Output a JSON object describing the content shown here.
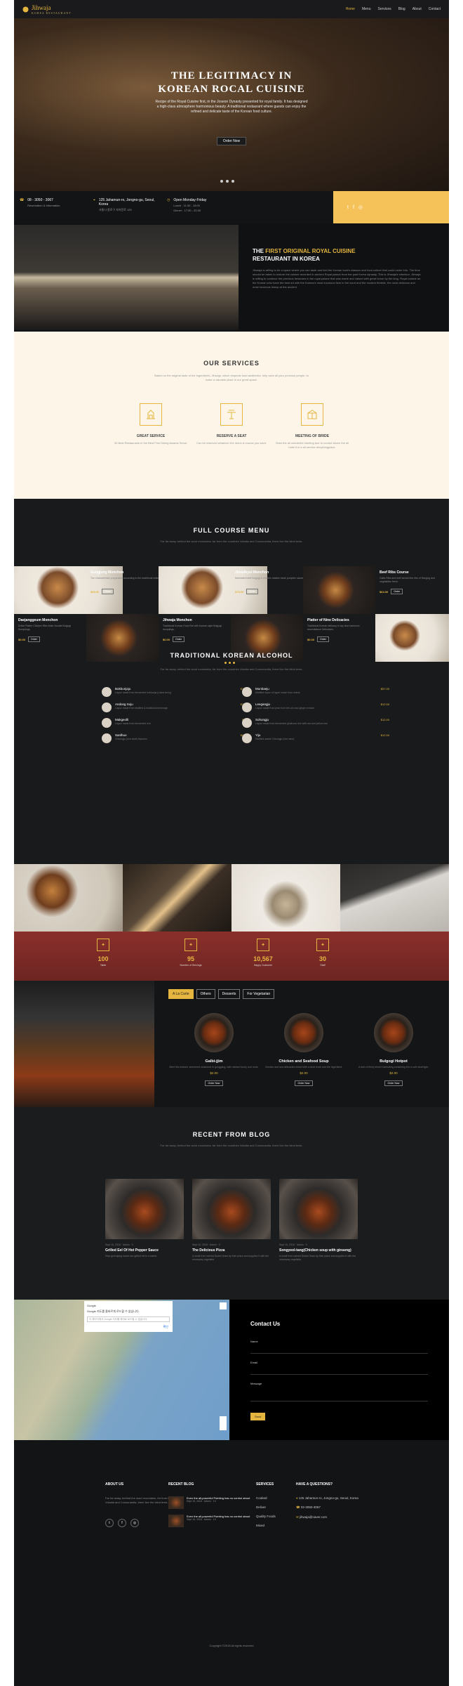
{
  "nav": {
    "brand": "Jihwaja",
    "brand_sub": "KOREA RESTAURANT",
    "items": [
      "Home",
      "Menu",
      "Services",
      "Blog",
      "About",
      "Contact"
    ],
    "active": "Home"
  },
  "hero": {
    "title_line1": "THE LEGITIMACY IN",
    "title_line2": "KOREAN ROCAL CUISINE",
    "text": "Recipe of the Royal Cuisine first, in the Joseon Dynasty presented for royal family. It has designed a high-class atmosphere harmonious beauty. A traditional restaurant where guests can enjoy the refined and delicate taste of the Korean food culture.",
    "button": "Order Now"
  },
  "info": {
    "phone": "08 - 3050 - 3067",
    "phone_sub": "Reservation & Information",
    "address": "125 Jahamun-ro, Jongno-gu, Seoul, Korea",
    "address_sub": "서울시 종로구 자하문로 125",
    "hours": "Open Monday-Friday",
    "lunch": "Lunch : 11:30 - 15:00",
    "dinner": "Dinner : 17:30 - 22:00"
  },
  "about": {
    "title_pre": "THE",
    "title_highlight": "FIRST ORIGINAL ROYAL CUISINE",
    "title_line2": "RESTAURANT IN KOREA",
    "text": "Jihwaja is willing to be a space where you can taste and feel the Korean food's classics and food culture that could usher into. The time should be taken to restore the cuisine recorded in ancient Royal palace from the past Korea dynasty. This is Jihwaja's intention. Jihwaja is willing to continue the precious treasures in the royal palace that was made and valued with great honor by the king. Royal cuisine as the Korean who have the best art with the Korean's most luxurious item in the court and the modern flexible, the most delicious and most luxurious lineup at the ancient."
  },
  "services": {
    "title": "OUR SERVICES",
    "lead": "Based on the original taste of the ingredients, Jihwaja, which respects food aesthetics, help save all your precious people, to make a valuable place in our great space.",
    "items": [
      {
        "title": "GREAT SERVICE",
        "text": "30 Best Restaurants in the Best Fine Dining Awards Seoul."
      },
      {
        "title": "RESERVE A SEAT",
        "text": "Can be reserved whatever the menu & course you want."
      },
      {
        "title": "MEETING OF BRIDE",
        "text": "Seek the all wonderful meeting tour to control above the all hotel it in a all service ahoythingplace."
      }
    ]
  },
  "fullmenu": {
    "title": "FULL COURSE MENU",
    "lead": "Far far away, behind the word mountains, far from the countries Vokalia and Consonantia, there live the blind texts.",
    "items": [
      {
        "name": "Gungjung Monchon",
        "desc": "The characteristic preparation according to the traditional materials such as Wonchaehil.",
        "price": "$65.00",
        "btn": "Order"
      },
      {
        "name": "Jinealbyul Monchon",
        "desc": "Marinated beef bulgogi & chicken maiden taste pumpkin sauce.",
        "price": "$75.00",
        "btn": "Order"
      },
      {
        "name": "Beef Ribs Course",
        "desc": "Galbi-Ribs and beef served the ribs of Hangug and vegetables fresh.",
        "price": "$64.00",
        "btn": "Order"
      },
      {
        "name": "Daejanggeum Monchon",
        "desc": "Dollar Platter Chicken Ribs Main Noodle Bulgogi Dumplings.",
        "price": "$0.00",
        "btn": "Order"
      },
      {
        "name": "Jihwaja Monchon",
        "desc": "Traditional Korean Food Set with Korean style Bulgogi dumplings.",
        "price": "$0.00",
        "btn": "Order"
      },
      {
        "name": "Platter of Nine Delicacies",
        "desc": "Traditional Korean delicacy in top nine harmonic resemblance Delicacies.",
        "price": "$0.00",
        "btn": "Order"
      }
    ]
  },
  "alcohol": {
    "title": "TRADITIONAL KOREAN ALCOHOL",
    "lead": "Far far away, behind the word mountains, far from the countries Vokalia and Consonantia, there live the blind texts.",
    "left": [
      {
        "name": "Bokbunjaju",
        "desc": "Liquor made from fermented bokbunja (rubus berry)",
        "price": "$16.00"
      },
      {
        "name": "Andong Soju",
        "desc": "Liquor made from distilled & traditional beverage",
        "price": "$25.00"
      },
      {
        "name": "Makgeolli",
        "desc": "Liquor made from fermented rice",
        "price": "$8.00"
      },
      {
        "name": "Sanlhuo",
        "desc": "Cheongju (rice wine) flavored",
        "price": "$60.00"
      }
    ],
    "right": [
      {
        "name": "Munbaeju",
        "desc": "Distilled liquor of hyper made from wheat",
        "price": "$57.00"
      },
      {
        "name": "Leegangju",
        "desc": "Liquor made from pear from lee-sin and ginger extract",
        "price": "$12.00"
      },
      {
        "name": "Sohongju",
        "desc": "Liquor made from fermented glutinous rice with red and yellow rice",
        "price": "$12.00"
      },
      {
        "name": "Yiju",
        "desc": "Distilled sweet Cheongju (rice wine)",
        "price": "$12.00"
      }
    ]
  },
  "counters": [
    {
      "value": "100",
      "label": "Table"
    },
    {
      "value": "95",
      "label": "Number of Servings"
    },
    {
      "value": "10,567",
      "label": "Happy Customer"
    },
    {
      "value": "30",
      "label": "Staff"
    }
  ],
  "carte": {
    "tabs": [
      "A La Carte",
      "Others",
      "Desserts",
      "For Vegetarian"
    ],
    "active": "A La Carte",
    "dishes": [
      {
        "name": "Galbi-jjim",
        "desc": "Beef ribs braised, simmered seasoned in gonggang, with rubbed honey and roots.",
        "price": "$2.00",
        "btn": "Order Now"
      },
      {
        "name": "Chicken and Seafood Soup",
        "desc": "Chicken and sea delicacies mixed with a clear broth and the ingredient.",
        "price": "$2.00",
        "btn": "Order Now"
      },
      {
        "name": "Bulgogi Hotpot",
        "desc": "A dish of thinly sliced marinating containing it to a soft meat light.",
        "price": "$2.00",
        "btn": "Order Now"
      }
    ]
  },
  "blog": {
    "title": "RECENT FROM BLOG",
    "lead": "Far far away, behind the word mountains, far from the countries Vokalia and Consonantia, there live the blind texts.",
    "posts": [
      {
        "meta": "Sept 10, 2018 · Admin · 3",
        "title": "Grilled Eel Of Hot Pepper Sauce",
        "text": "Hwa gochujang sauce are grilled eel in a sweet."
      },
      {
        "meta": "Sept 10, 2018 · Admin · 3",
        "title": "The Delicious Pizza",
        "text": "A small river named Duden flows by their place and supplies it with the necessary regelialia."
      },
      {
        "meta": "Sept 10, 2018 · Admin · 3",
        "title": "Songyeol-tang(Chicken soup with ginseng)",
        "text": "A small river named Duden flows by their place and supplies it with the necessary regelialia."
      }
    ]
  },
  "map": {
    "title": "Google",
    "text": "Google 지도를 올바르게 로드할 수 없습니다.",
    "subtext": "이 페이지에서 Google 지도를 제대로 로드할 수 없습니다.",
    "ok": "확인"
  },
  "contact": {
    "title": "Contact Us",
    "name": "Name",
    "email": "Email",
    "message": "Message",
    "send": "Send"
  },
  "footer": {
    "about_title": "ABOUT US",
    "about_text": "Far far away, behind the word mountains, far from the countries Vokalia and Consonantia, there live the blind texts.",
    "recent_title": "RECENT BLOG",
    "recent": [
      {
        "title": "Even the all-powerful Pointing has no control about",
        "meta": "Sept 15, 2018 · Admin · 19"
      },
      {
        "title": "Even the all-powerful Pointing has no control about",
        "meta": "Sept 15, 2018 · Admin · 19"
      }
    ],
    "services_title": "SERVICES",
    "services": [
      "Cooked",
      "Deliver",
      "Quality Foods",
      "Mixed"
    ],
    "question_title": "HAVE A QUESTIONS?",
    "address": "125 Jahamun-ro, Jongno-gu, Seoul, Korea",
    "phone": "02-3050-3067",
    "email": "jihwaja@naver.com",
    "copyright": "Copyright ©2018 All rights reserved"
  },
  "colors": {
    "accent": "#e5b63f",
    "dark": "#141517",
    "cream": "#fcf5e8",
    "yellow_bar": "#f5c259"
  }
}
